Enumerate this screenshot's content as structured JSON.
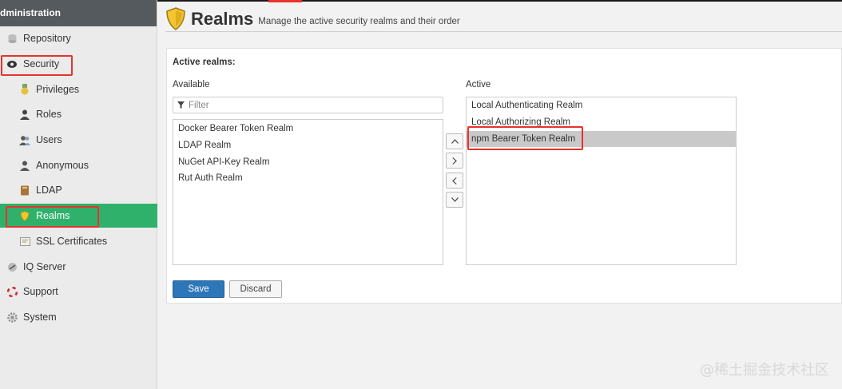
{
  "sidebar": {
    "header": "dministration",
    "items": [
      {
        "label": "Repository"
      },
      {
        "label": "Security"
      },
      {
        "label": "Privileges"
      },
      {
        "label": "Roles"
      },
      {
        "label": "Users"
      },
      {
        "label": "Anonymous"
      },
      {
        "label": "LDAP"
      },
      {
        "label": "Realms"
      },
      {
        "label": "SSL Certificates"
      },
      {
        "label": "IQ Server"
      },
      {
        "label": "Support"
      },
      {
        "label": "System"
      }
    ]
  },
  "header": {
    "title": "Realms",
    "subtitle": "Manage the active security realms and their order"
  },
  "form": {
    "section_title": "Active realms:",
    "available_label": "Available",
    "active_label": "Active",
    "filter_placeholder": "Filter",
    "available": [
      "Docker Bearer Token Realm",
      "LDAP Realm",
      "NuGet API-Key Realm",
      "Rut Auth Realm"
    ],
    "active": [
      "Local Authenticating Realm",
      "Local Authorizing Realm",
      "npm Bearer Token Realm"
    ],
    "selected_active": "npm Bearer Token Realm",
    "save_label": "Save",
    "discard_label": "Discard"
  },
  "watermark": "@稀土掘金技术社区",
  "colors": {
    "accent": "#2fb16b",
    "header_bg": "#555a5e",
    "primary_button": "#2d77b8",
    "highlight": "#e8322d"
  }
}
